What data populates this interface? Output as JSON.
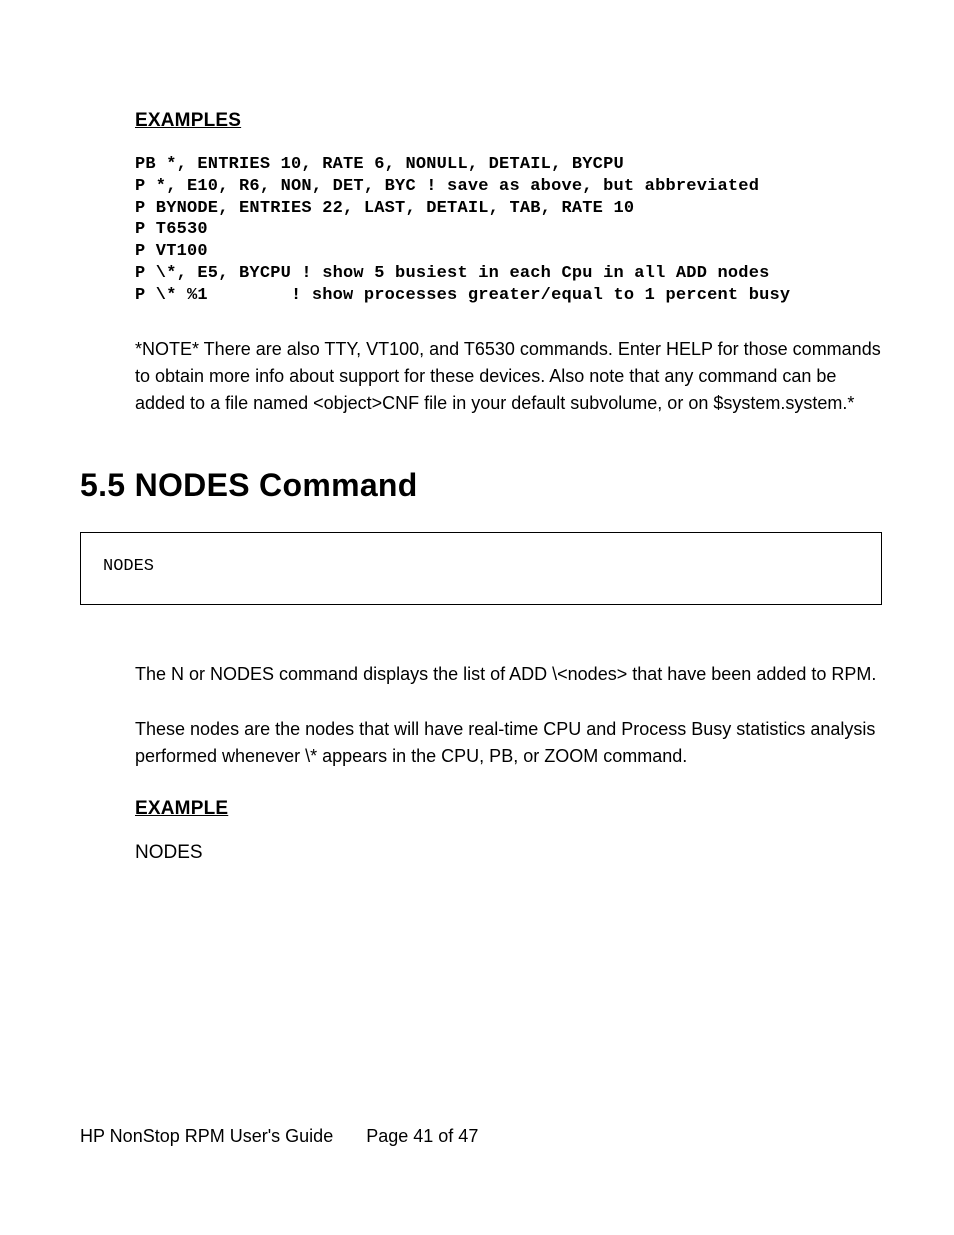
{
  "headings": {
    "examples": "EXAMPLES",
    "section": "5.5 NODES Command",
    "example": "EXAMPLE"
  },
  "code_block": "PB *, ENTRIES 10, RATE 6, NONULL, DETAIL, BYCPU\nP *, E10, R6, NON, DET, BYC ! save as above, but abbreviated\nP BYNODE, ENTRIES 22, LAST, DETAIL, TAB, RATE 10\nP T6530\nP VT100\nP \\*, E5, BYCPU ! show 5 busiest in each Cpu in all ADD nodes\nP \\* %1        ! show processes greater/equal to 1 percent busy",
  "note_para": "*NOTE* There are also TTY, VT100, and T6530 commands.  Enter HELP for those commands to obtain more info about support for these devices.  Also note that any command can be added to a file named <object>CNF file in your default subvolume, or on $system.system.*",
  "syntax_box": "NODES",
  "body_para_1": "The N or NODES command displays the list of ADD \\<nodes> that have been added to RPM.",
  "body_para_2": "These nodes are the nodes that will have real-time CPU and Process Busy statistics analysis performed whenever \\* appears in the CPU, PB, or ZOOM command.",
  "example_text": "NODES",
  "footer": {
    "guide": "HP NonStop RPM User's Guide",
    "page": "Page 41 of 47"
  }
}
